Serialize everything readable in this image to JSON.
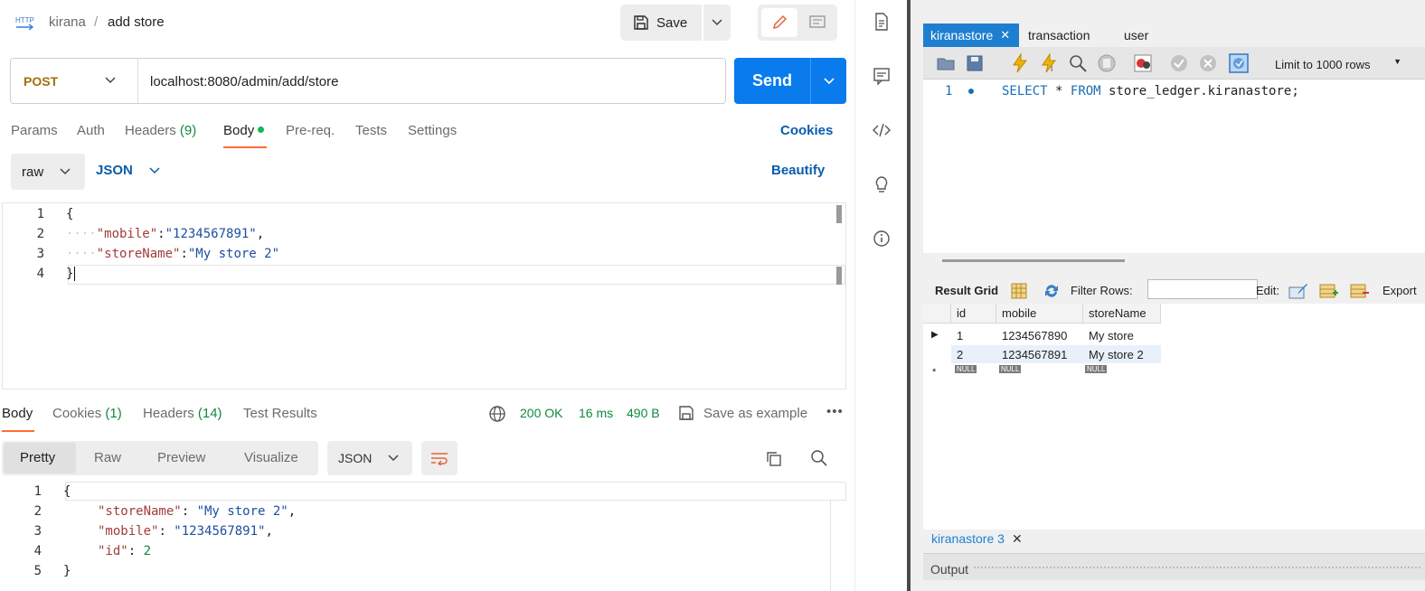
{
  "postman": {
    "breadcrumb": {
      "collection": "kirana",
      "separator": "/",
      "request": "add store"
    },
    "save_label": "Save",
    "method": "POST",
    "url": "localhost:8080/admin/add/store",
    "send_label": "Send",
    "request_tabs": [
      {
        "label": "Params"
      },
      {
        "label": "Auth"
      },
      {
        "label": "Headers",
        "count": "(9)"
      },
      {
        "label": "Body"
      },
      {
        "label": "Pre-req."
      },
      {
        "label": "Tests"
      },
      {
        "label": "Settings"
      }
    ],
    "cookies_label": "Cookies",
    "body_type": "raw",
    "body_format": "JSON",
    "beautify_label": "Beautify",
    "request_body": {
      "line_numbers": [
        "1",
        "2",
        "3",
        "4"
      ],
      "open_brace": "{",
      "close_brace": "}",
      "mobile_key": "\"mobile\"",
      "mobile_value": "\"1234567891\"",
      "storename_key": "\"storeName\"",
      "storename_value": "\"My store 2\""
    },
    "response_tabs": [
      {
        "label": "Body"
      },
      {
        "label": "Cookies",
        "count": "(1)"
      },
      {
        "label": "Headers",
        "count": "(14)"
      },
      {
        "label": "Test Results"
      }
    ],
    "response_status": "200 OK",
    "response_time": "16 ms",
    "response_size": "490 B",
    "save_example_label": "Save as example",
    "view_modes": [
      "Pretty",
      "Raw",
      "Preview",
      "Visualize"
    ],
    "response_format": "JSON",
    "response_body": {
      "line_numbers": [
        "1",
        "2",
        "3",
        "4",
        "5"
      ],
      "open_brace": "{",
      "close_brace": "}",
      "storename_key": "\"storeName\"",
      "storename_value": "\"My store 2\"",
      "mobile_key": "\"mobile\"",
      "mobile_value": "\"1234567891\"",
      "id_key": "\"id\"",
      "id_value": "2"
    }
  },
  "workbench": {
    "tabs": [
      "kiranastore",
      "transaction",
      "user"
    ],
    "limit_label": "Limit to 1000 rows",
    "query": {
      "line_number": "1",
      "select": "SELECT",
      "star": "*",
      "from": "FROM",
      "table": "store_ledger.kiranastore;"
    },
    "result_grid_label": "Result Grid",
    "filter_rows_label": "Filter Rows:",
    "edit_label": "Edit:",
    "export_label": "Export",
    "columns": [
      "id",
      "mobile",
      "storeName"
    ],
    "rows": [
      [
        "1",
        "1234567890",
        "My store"
      ],
      [
        "2",
        "1234567891",
        "My store 2"
      ]
    ],
    "null_label": "NULL",
    "result_tab": "kiranastore 3",
    "output_label": "Output"
  },
  "colors": {
    "send_blue": "#097bed",
    "post_orange": "#a0700b",
    "active_tab_accent": "#ff6c37",
    "status_green": "#0f8a3c",
    "workbench_tab_blue": "#1e7fd0"
  }
}
